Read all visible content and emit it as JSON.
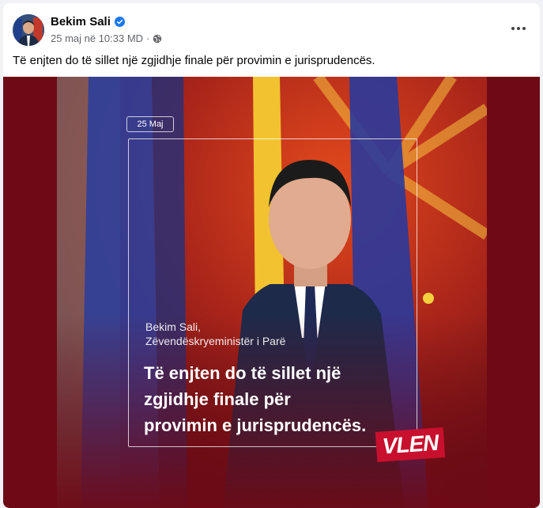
{
  "post": {
    "author": "Bekim Sali",
    "timestamp": "25 maj në 10:33 MD",
    "separator": "·",
    "caption": "Të enjten do të sillet një zgjidhje finale për provimin e jurisprudencës."
  },
  "image": {
    "date_label": "25 Maj",
    "name_line1": "Bekim Sali,",
    "name_line2": "Zëvendëskryeministër i Parë",
    "quote_line1": "Të enjten do të sillet një",
    "quote_line2": "zgjidhje finale për",
    "quote_line3": "provimin e jurisprudencës.",
    "logo": "VLEN"
  },
  "colors": {
    "verified": "#1877f2",
    "maroon": "#6e0a16",
    "brand_red": "#c8102e"
  },
  "icons": [
    "verified-badge-icon",
    "globe-icon",
    "more-options-icon"
  ]
}
